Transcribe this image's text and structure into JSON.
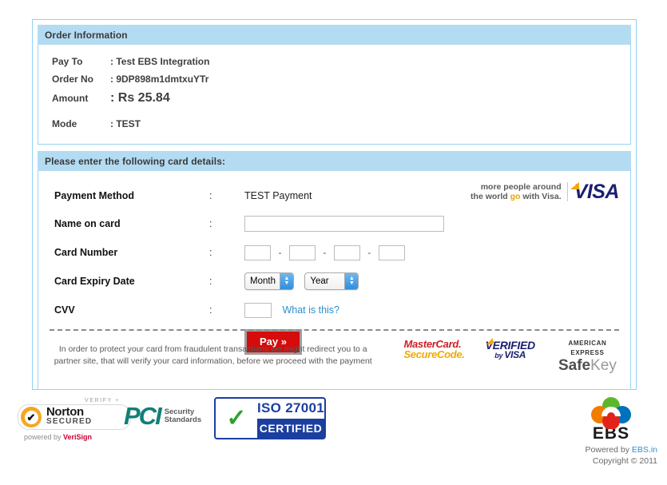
{
  "order": {
    "header": "Order Information",
    "rows": [
      {
        "label": "Pay To",
        "value": ": Test EBS Integration"
      },
      {
        "label": "Order No",
        "value": ": 9DP898m1dmtxuYTr"
      },
      {
        "label": "Amount",
        "value": ": Rs 25.84"
      }
    ],
    "mode_label": "Mode",
    "mode_value": ": TEST"
  },
  "form": {
    "header": "Please enter the following card details:",
    "colon": ":",
    "payment_method": {
      "label": "Payment Method",
      "value": "TEST Payment"
    },
    "name_on_card": {
      "label": "Name on card",
      "value": "",
      "placeholder": ""
    },
    "card_number": {
      "label": "Card Number",
      "separator": "-",
      "parts": [
        "",
        "",
        "",
        ""
      ]
    },
    "expiry": {
      "label": "Card Expiry Date",
      "month_selected": "Month",
      "year_selected": "Year"
    },
    "cvv": {
      "label": "CVV",
      "value": "",
      "help_link": "What is this?"
    },
    "pay_button": "Pay »",
    "disclaimer": "In order to protect your card from fraudulent transactions we might redirect you to a partner site, that will verify your card information, before we proceed with the payment"
  },
  "visa_banner": {
    "line1_before": "more people around",
    "line2_before": "the world ",
    "line2_highlight": "go",
    "line2_after": " with Visa.",
    "logo": "VISA",
    "highlight_color": "#e8a400",
    "logo_color": "#1a1f71"
  },
  "security_badges": {
    "mastercard": {
      "line1": "MasterCard.",
      "line2": "SecureCode."
    },
    "verified_visa": {
      "line1": "VERIFIED",
      "line2_small": "by ",
      "line2": "VISA"
    },
    "amex": {
      "line1": "AMERICAN EXPRESS",
      "line2_bold": "Safe",
      "line2_light": "Key"
    }
  },
  "trust_seals": {
    "norton": {
      "verify": "VERIFY +",
      "line1": "Norton",
      "line2": "SECURED",
      "powered_prefix": "powered by ",
      "powered_brand": "VeriSign"
    },
    "pci": {
      "mark": "PCI",
      "line1": "Security",
      "line2": "Standards"
    },
    "iso": {
      "top": "ISO 27001",
      "bottom": "CERTIFIED"
    }
  },
  "footer": {
    "logo_word": "EBS",
    "powered_prefix": "Powered by ",
    "powered_link": "EBS.in",
    "copyright": "Copyright © 2011"
  },
  "theme": {
    "bar_blue": "#b3dbf2",
    "border_blue": "#8fd2ef",
    "pay_red": "#d60b0b",
    "link_blue": "#2e8fd0"
  }
}
